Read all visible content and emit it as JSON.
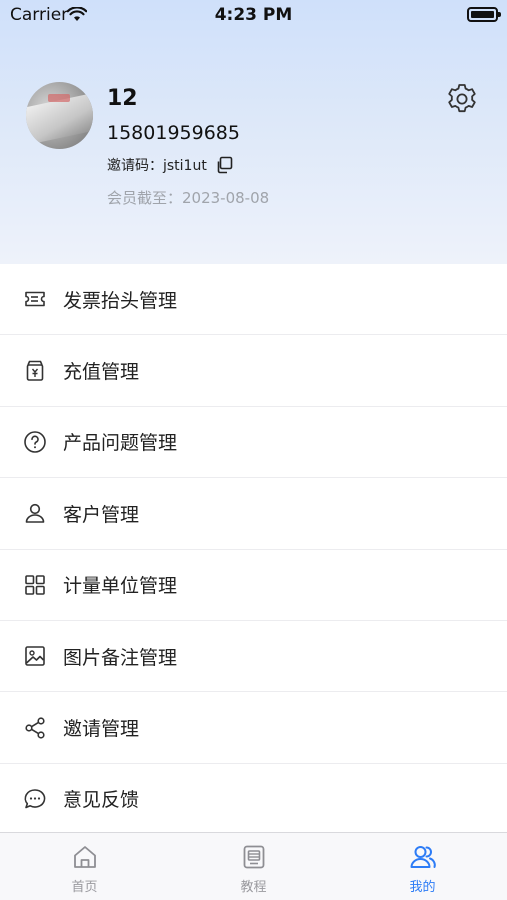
{
  "status_bar": {
    "carrier": "Carrier",
    "time": "4:23 PM"
  },
  "profile": {
    "name": "12",
    "phone": "15801959685",
    "invite_code": "邀请码：jsti1ut",
    "member_until": "会员截至：2023-08-08"
  },
  "menu": {
    "items": [
      {
        "label": "发票抬头管理",
        "icon": "invoice-icon"
      },
      {
        "label": "充值管理",
        "icon": "recharge-icon"
      },
      {
        "label": "产品问题管理",
        "icon": "question-icon"
      },
      {
        "label": "客户管理",
        "icon": "user-icon"
      },
      {
        "label": "计量单位管理",
        "icon": "grid-icon"
      },
      {
        "label": "图片备注管理",
        "icon": "image-icon"
      },
      {
        "label": "邀请管理",
        "icon": "share-icon"
      },
      {
        "label": "意见反馈",
        "icon": "chat-icon"
      }
    ]
  },
  "tabbar": {
    "tabs": [
      {
        "label": "首页",
        "icon": "home-icon"
      },
      {
        "label": "教程",
        "icon": "tutorial-icon"
      },
      {
        "label": "我的",
        "icon": "profile-icon",
        "active": true
      }
    ]
  },
  "colors": {
    "accent": "#2d7cf6",
    "header_top": "#cfe0fa"
  }
}
